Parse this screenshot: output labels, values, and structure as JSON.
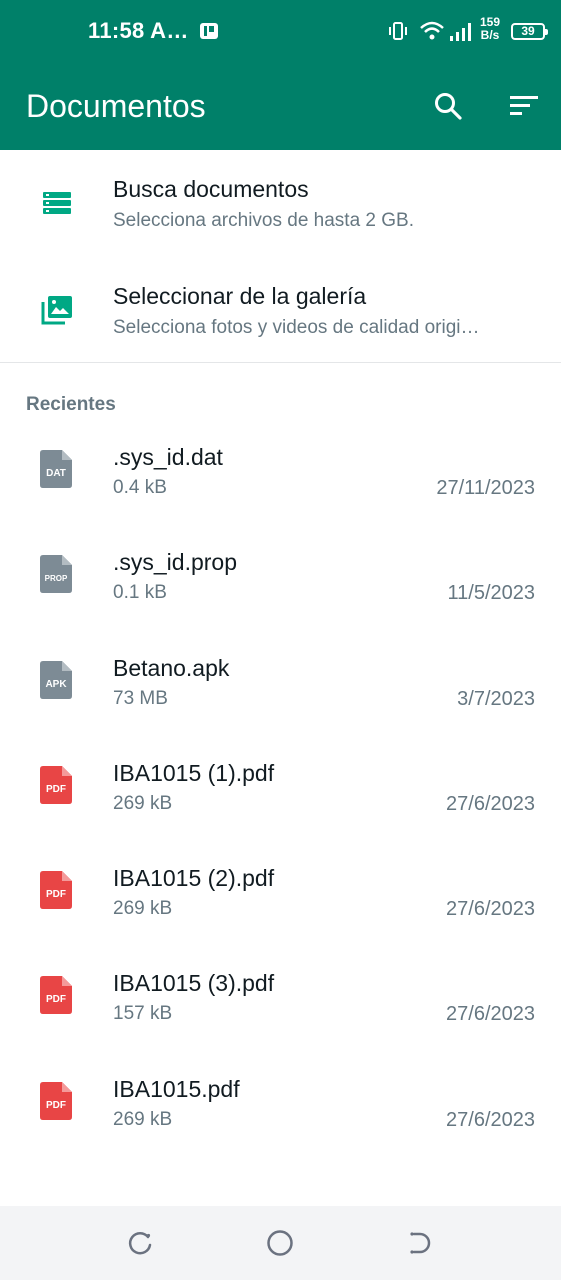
{
  "status_bar": {
    "time": "11:58 A…",
    "net_speed_value": "159",
    "net_speed_unit": "B/s",
    "battery": "39",
    "icons": [
      "app-notification-icon",
      "vibrate-icon",
      "wifi-icon",
      "signal-icon",
      "battery-icon"
    ]
  },
  "toolbar": {
    "title": "Documentos",
    "search_icon": "search-icon",
    "sort_icon": "sort-icon",
    "background": "#008069"
  },
  "actions": [
    {
      "title": "Busca documentos",
      "subtitle": "Selecciona archivos de hasta 2 GB.",
      "icon": "list-icon"
    },
    {
      "title": "Seleccionar de la galería",
      "subtitle": "Selecciona fotos y videos de calidad origi…",
      "icon": "gallery-icon"
    }
  ],
  "recent": {
    "header": "Recientes",
    "files": [
      {
        "name": ".sys_id.dat",
        "size": "0.4 kB",
        "date": "27/11/2023",
        "type": "DAT",
        "color": "#7d8b95"
      },
      {
        "name": ".sys_id.prop",
        "size": "0.1 kB",
        "date": "11/5/2023",
        "type": "PROP",
        "color": "#7d8b95"
      },
      {
        "name": "Betano.apk",
        "size": "73 MB",
        "date": "3/7/2023",
        "type": "APK",
        "color": "#7d8b95"
      },
      {
        "name": "IBA1015 (1).pdf",
        "size": "269 kB",
        "date": "27/6/2023",
        "type": "PDF",
        "color": "#e84545"
      },
      {
        "name": "IBA1015 (2).pdf",
        "size": "269 kB",
        "date": "27/6/2023",
        "type": "PDF",
        "color": "#e84545"
      },
      {
        "name": "IBA1015 (3).pdf",
        "size": "157 kB",
        "date": "27/6/2023",
        "type": "PDF",
        "color": "#e84545"
      },
      {
        "name": "IBA1015.pdf",
        "size": "269 kB",
        "date": "27/6/2023",
        "type": "PDF",
        "color": "#e84545"
      }
    ]
  },
  "nav_bar": {
    "icons": [
      "recents-icon",
      "home-icon",
      "back-icon"
    ]
  },
  "colors": {
    "accent": "#008069",
    "secondary_text": "#667781",
    "primary_text": "#111b21"
  }
}
